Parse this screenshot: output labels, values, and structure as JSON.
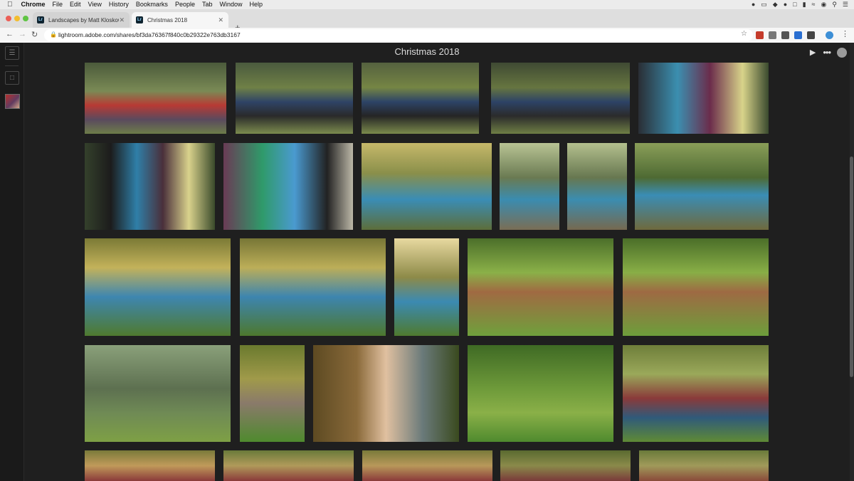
{
  "menubar": {
    "app": "Chrome",
    "items": [
      "File",
      "Edit",
      "View",
      "History",
      "Bookmarks",
      "People",
      "Tab",
      "Window",
      "Help"
    ]
  },
  "tabs": [
    {
      "label": "Landscapes by Matt Kloskowski"
    },
    {
      "label": "Christmas 2018"
    }
  ],
  "address": {
    "url": "lightroom.adobe.com/shares/bf3da76367f840c0b29322e763db3167"
  },
  "album": {
    "title": "Christmas 2018"
  },
  "icons": {
    "apple": "apple-icon",
    "close": "close-icon",
    "plus": "plus-icon",
    "back": "back-arrow-icon",
    "forward": "forward-arrow-icon",
    "reload": "reload-icon",
    "lock": "lock-icon",
    "star": "bookmark-star-icon",
    "play": "play-icon",
    "more": "more-icon",
    "user": "user-icon",
    "menu": "panel-icon"
  },
  "colors": {
    "background": "#1f1f1f",
    "title_text": "#dcdcdc"
  }
}
